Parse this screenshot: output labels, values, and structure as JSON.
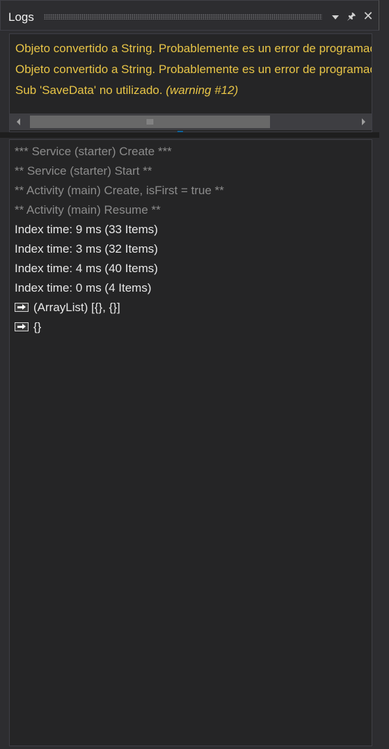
{
  "panel": {
    "title": "Logs"
  },
  "toolbar": {
    "dropdown_icon": "chevron-down-icon",
    "pin_icon": "pin-icon",
    "pin_glyph": "🖈",
    "close_icon": "close-icon",
    "close_glyph": "✕"
  },
  "errors": {
    "lines": [
      {
        "text": "Objeto convertido a String. Probablemente es un error de programación.",
        "tag": ""
      },
      {
        "text": "Objeto convertido a String. Probablemente es un error de programación.",
        "tag": ""
      },
      {
        "text": "Sub 'SaveData' no utilizado.",
        "tag": "(warning #12)"
      }
    ],
    "color": "#e8c547"
  },
  "log": {
    "lines": [
      {
        "text": "*** Service (starter) Create ***",
        "style": "dim"
      },
      {
        "text": "** Service (starter) Start **",
        "style": "dim"
      },
      {
        "text": "** Activity (main) Create, isFirst = true **",
        "style": "dim"
      },
      {
        "text": "** Activity (main) Resume **",
        "style": "dim"
      },
      {
        "text": "Index time: 9 ms (33 Items)",
        "style": "normal"
      },
      {
        "text": "Index time: 3 ms (32 Items)",
        "style": "normal"
      },
      {
        "text": "Index time: 4 ms (40 Items)",
        "style": "normal"
      },
      {
        "text": "Index time: 0 ms (4 Items)",
        "style": "normal"
      },
      {
        "text": "(ArrayList) [{}, {}]",
        "style": "normal",
        "icon": "arrow-right-box-icon"
      },
      {
        "text": "{}",
        "style": "normal",
        "icon": "arrow-right-box-icon"
      }
    ]
  }
}
